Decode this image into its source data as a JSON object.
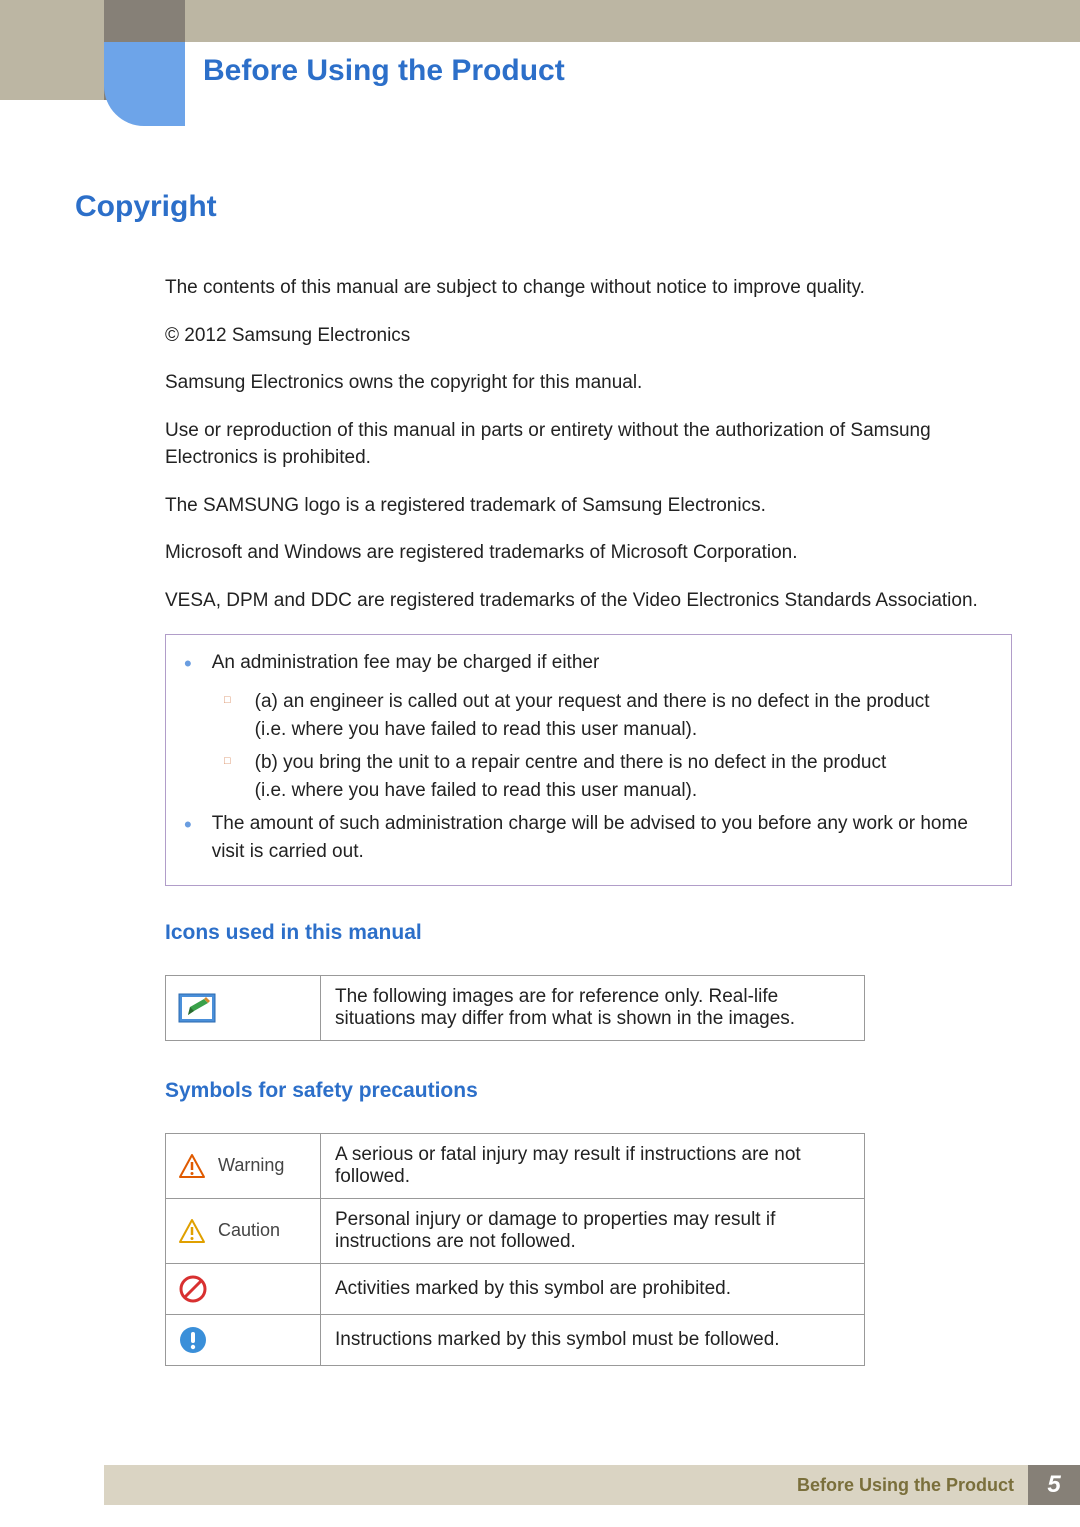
{
  "header": {
    "title": "Before Using the Product"
  },
  "section": {
    "title": "Copyright"
  },
  "paragraphs": {
    "p1": "The contents of this manual are subject to change without notice to improve quality.",
    "p2": "© 2012 Samsung Electronics",
    "p3": "Samsung Electronics owns the copyright for this manual.",
    "p4": "Use or reproduction of this manual in parts or entirety without the authorization of Samsung Electronics is prohibited.",
    "p5": "The SAMSUNG logo is a registered trademark of Samsung Electronics.",
    "p6": "Microsoft and Windows are registered trademarks of Microsoft Corporation.",
    "p7": "VESA, DPM and DDC are registered trademarks of the Video Electronics Standards Association."
  },
  "fee_box": {
    "b1": "An administration fee may be charged if either",
    "sub_a": "(a) an engineer is called out at your request and there is no defect in the product",
    "sub_a2": "(i.e. where you have failed to read this user manual).",
    "sub_b": "(b) you bring the unit to a repair centre and there is no defect in the product",
    "sub_b2": "(i.e. where you have failed to read this user manual).",
    "b2": "The amount of such administration charge will be advised to you before any work or home visit is carried out."
  },
  "icons_section": {
    "title": "Icons used in this manual",
    "row1_text": "The following images are for reference only. Real-life situations may differ from what is shown in the images."
  },
  "symbols_section": {
    "title": "Symbols for safety precautions",
    "warning_label": "Warning",
    "warning_text": "A serious or fatal injury may result if instructions are not followed.",
    "caution_label": "Caution",
    "caution_text": "Personal injury or damage to properties may result if instructions are not followed.",
    "prohibited_text": "Activities marked by this symbol are prohibited.",
    "must_text": "Instructions marked by this symbol must be followed."
  },
  "footer": {
    "text": "Before Using the Product",
    "page": "5"
  }
}
